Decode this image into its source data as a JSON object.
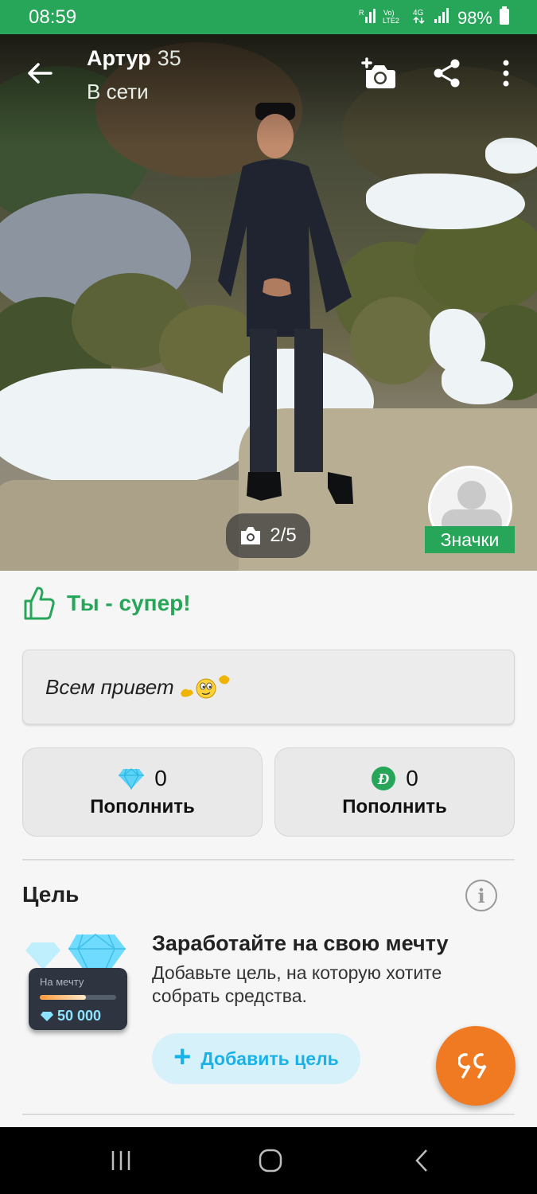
{
  "status_bar": {
    "time": "08:59",
    "network_labels": "R Vo) LTE2 4G",
    "battery": "98%"
  },
  "header": {
    "name": "Артур",
    "age": "35",
    "status": "В сети"
  },
  "photo": {
    "counter": "2/5",
    "badges_label": "Значки"
  },
  "like": {
    "text": "Ты - супер!"
  },
  "about": {
    "text": "Всем привет"
  },
  "wallets": [
    {
      "amount": "0",
      "action": "Пополнить",
      "icon": "diamond-icon"
    },
    {
      "amount": "0",
      "action": "Пополнить",
      "icon": "coin-icon"
    }
  ],
  "goal": {
    "section_title": "Цель",
    "heading": "Заработайте на свою мечту",
    "description": "Добавьте цель, на которую хотите собрать средства.",
    "button_label": "Добавить цель",
    "illustration": {
      "card_label": "На мечту",
      "amount": "50 000"
    }
  },
  "colors": {
    "brand_green": "#27a65a",
    "accent_orange": "#f07a22",
    "accent_blue": "#18b2e8"
  }
}
